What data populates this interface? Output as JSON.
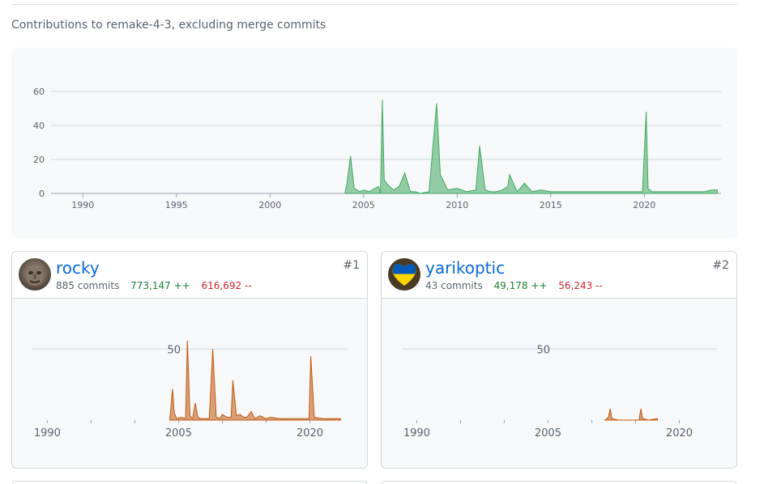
{
  "page": {
    "subtitle": "Contributions to remake-4-3, excluding merge commits"
  },
  "colors": {
    "accent_link": "#0969da",
    "additions": "#1a7f37",
    "deletions": "#d1242f",
    "main_area": "#40a85d",
    "contributor_area": "#c2570c"
  },
  "chart_data": [
    {
      "type": "area",
      "name": "repository-contributions",
      "title": "",
      "xlabel": "",
      "ylabel": "",
      "x_ticks": [
        "1990",
        "1995",
        "2000",
        "2005",
        "2010",
        "2015",
        "2020"
      ],
      "y_ticks": [
        "0",
        "20",
        "40",
        "60"
      ],
      "xlim": [
        1988.3,
        2024.1
      ],
      "ylim": [
        0,
        60
      ],
      "grid": true,
      "series": [
        {
          "x": [
            2004.0,
            2004.1,
            2004.3,
            2004.5,
            2004.8,
            2005.0,
            2005.3,
            2005.6,
            2005.8,
            2005.9,
            2006.0,
            2006.1,
            2006.3,
            2006.6,
            2006.9,
            2007.2,
            2007.5,
            2007.8,
            2008.0,
            2008.5,
            2008.9,
            2009.1,
            2009.5,
            2010.0,
            2010.5,
            2011.0,
            2011.2,
            2011.5,
            2011.8,
            2012.1,
            2012.4,
            2012.7,
            2012.8,
            2013.2,
            2013.6,
            2014.0,
            2014.5,
            2015.0,
            2015.5,
            2016.0,
            2017.0,
            2017.5,
            2018.0,
            2019.0,
            2019.5,
            2019.9,
            2020.1,
            2020.2,
            2020.4,
            2020.8,
            2021.3,
            2021.8,
            2022.3,
            2022.8,
            2023.2,
            2023.6,
            2023.9
          ],
          "values": [
            0,
            5,
            22,
            3,
            1,
            2,
            1,
            3,
            4,
            0,
            55,
            8,
            5,
            2,
            4,
            12,
            1,
            1,
            0,
            1,
            53,
            11,
            2,
            3,
            1,
            2,
            28,
            2,
            1,
            1,
            2,
            4,
            11,
            1,
            6,
            1,
            2,
            1,
            1,
            1,
            1,
            1,
            1,
            1,
            1,
            1,
            48,
            3,
            1,
            1,
            1,
            1,
            1,
            1,
            1,
            2,
            2
          ]
        }
      ]
    },
    {
      "type": "area",
      "name": "rocky-contributions",
      "x_ticks": [
        "1990",
        "2005",
        "2020"
      ],
      "y_ticks": [
        "50"
      ],
      "xlim": [
        1988.3,
        2024.3
      ],
      "ylim": [
        0,
        57
      ],
      "grid": true,
      "series": [
        {
          "x": [
            2004.0,
            2004.3,
            2004.5,
            2004.8,
            2005.3,
            2005.8,
            2006.0,
            2006.3,
            2006.6,
            2006.9,
            2007.2,
            2007.5,
            2008.0,
            2008.5,
            2008.9,
            2009.3,
            2009.7,
            2010.0,
            2010.5,
            2011.0,
            2011.2,
            2011.6,
            2012.0,
            2012.4,
            2012.8,
            2013.3,
            2013.7,
            2014.3,
            2015.0,
            2015.5,
            2016.5,
            2018.0,
            2019.0,
            2019.9,
            2020.1,
            2020.5,
            2021.5,
            2022.5,
            2023.5
          ],
          "values": [
            0,
            22,
            5,
            1,
            2,
            1,
            56,
            3,
            1,
            12,
            2,
            1,
            1,
            1,
            50,
            2,
            1,
            4,
            2,
            2,
            28,
            3,
            4,
            2,
            2,
            6,
            1,
            3,
            1,
            2,
            1,
            1,
            1,
            1,
            45,
            2,
            1,
            1,
            1
          ]
        }
      ]
    },
    {
      "type": "area",
      "name": "yarikoptic-contributions",
      "x_ticks": [
        "1990",
        "2005",
        "2020"
      ],
      "y_ticks": [
        "50"
      ],
      "xlim": [
        1988.3,
        2024.3
      ],
      "ylim": [
        0,
        57
      ],
      "grid": true,
      "series": [
        {
          "x": [
            2011.5,
            2011.9,
            2012.1,
            2012.3,
            2013.0,
            2015.4,
            2015.6,
            2015.8,
            2016.5,
            2017.5
          ],
          "values": [
            0,
            2,
            8,
            1,
            0,
            0,
            8,
            1,
            0,
            1
          ]
        }
      ]
    }
  ],
  "contributors": [
    {
      "name": "rocky",
      "commits": "885 commits",
      "additions": "773,147 ++",
      "deletions": "616,692 --",
      "rank": "#1"
    },
    {
      "name": "yarikoptic",
      "commits": "43 commits",
      "additions": "49,178 ++",
      "deletions": "56,243 --",
      "rank": "#2"
    }
  ]
}
